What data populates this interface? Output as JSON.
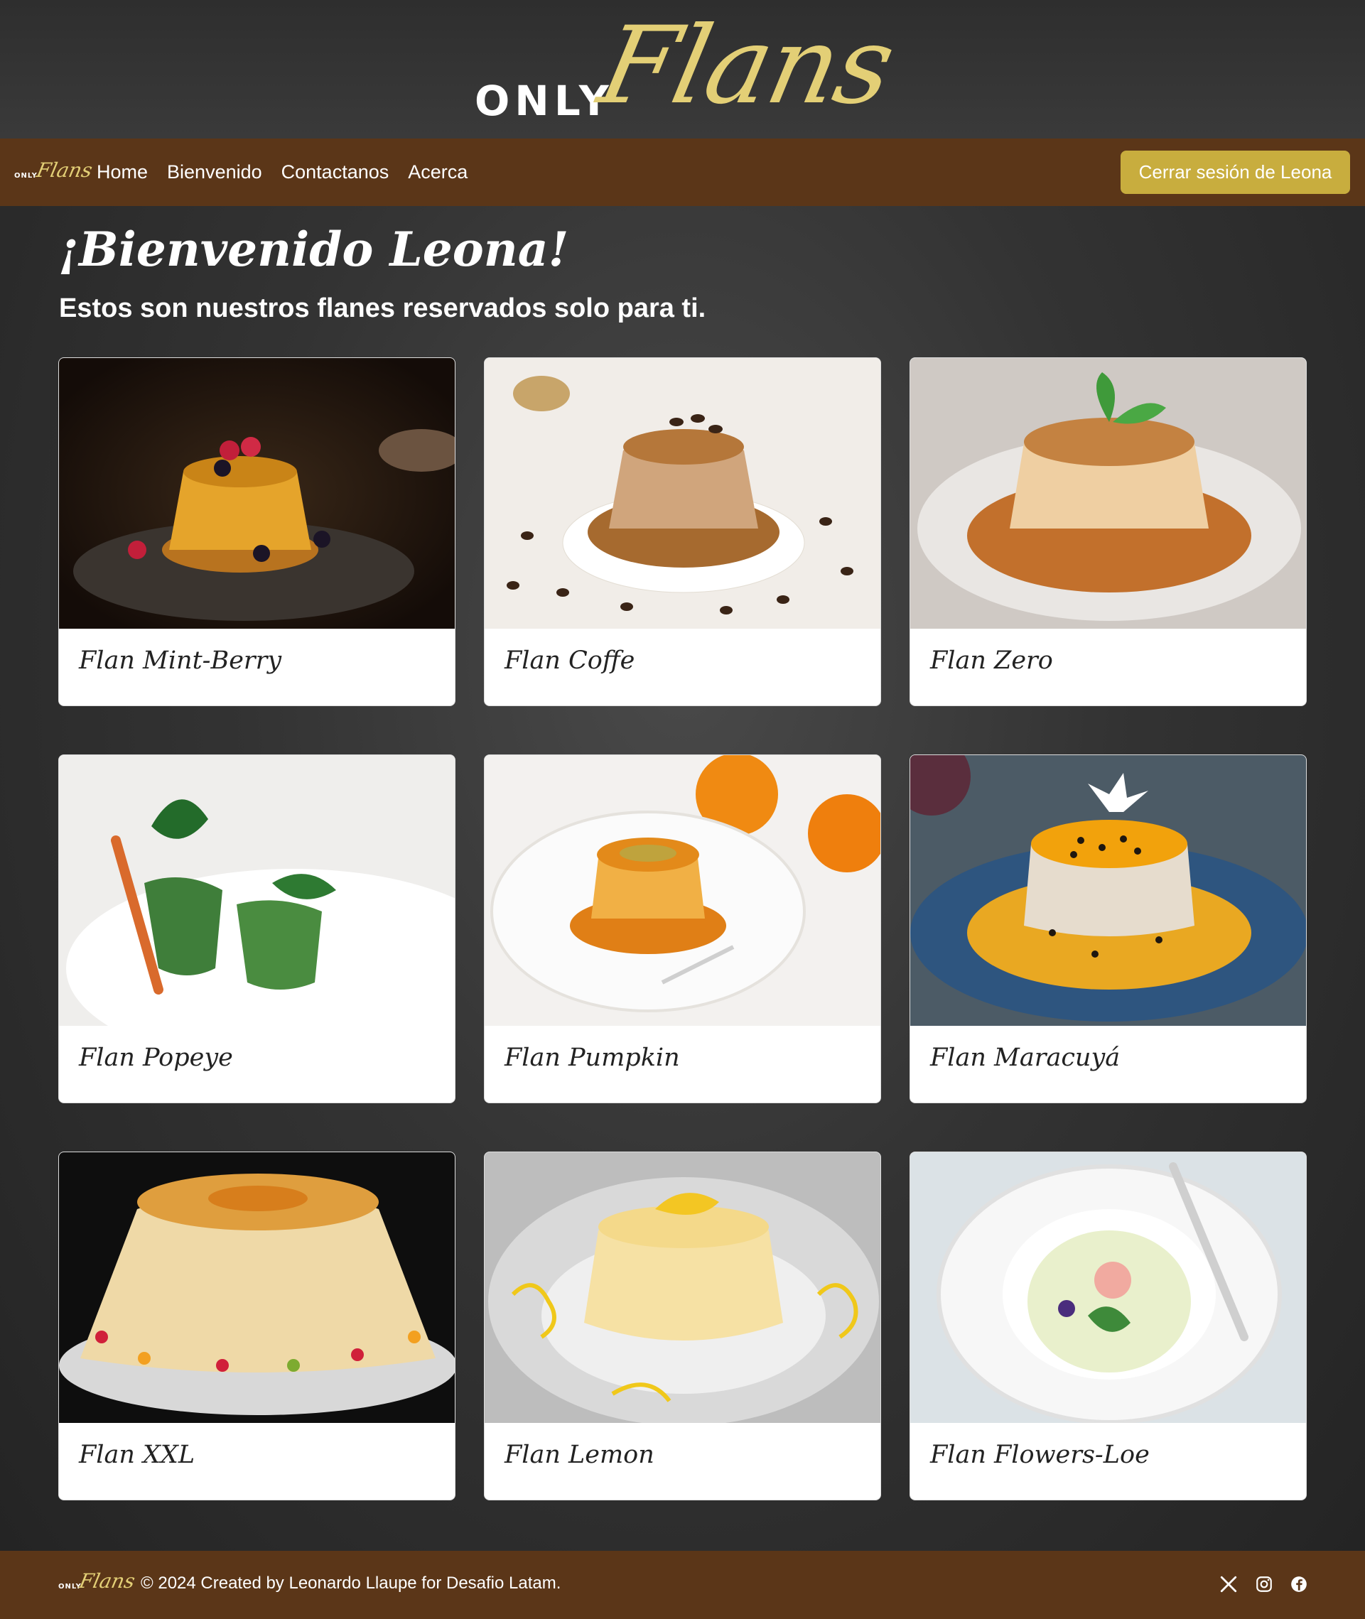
{
  "brand": {
    "only": "ONLY",
    "flans": "Flans"
  },
  "nav": {
    "links": [
      "Home",
      "Bienvenido",
      "Contactanos",
      "Acerca"
    ],
    "logout_label": "Cerrar sesión de Leona"
  },
  "welcome": {
    "title": "¡Bienvenido Leona!",
    "subtitle": "Estos son nuestros flanes reservados solo para ti."
  },
  "cards": [
    {
      "title": "Flan Mint-Berry"
    },
    {
      "title": "Flan Coffe"
    },
    {
      "title": "Flan Zero"
    },
    {
      "title": "Flan Popeye"
    },
    {
      "title": "Flan Pumpkin"
    },
    {
      "title": "Flan Maracuyá"
    },
    {
      "title": "Flan XXL"
    },
    {
      "title": "Flan Lemon"
    },
    {
      "title": "Flan Flowers-Loe"
    }
  ],
  "footer": {
    "text": "© 2024 Created by Leonardo Llaupe for Desafio Latam.",
    "social": [
      "x-icon",
      "instagram-icon",
      "facebook-icon"
    ]
  },
  "colors": {
    "nav_bg": "#5b3618",
    "accent_gold": "#c8ad3e",
    "brand_gold": "#e3cf76"
  }
}
